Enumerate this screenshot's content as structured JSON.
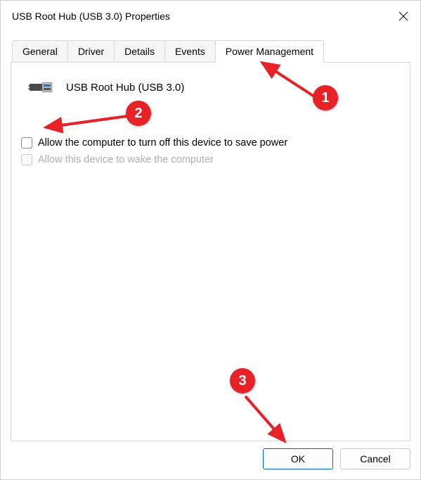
{
  "window": {
    "title": "USB Root Hub (USB 3.0) Properties"
  },
  "tabs": {
    "general": "General",
    "driver": "Driver",
    "details": "Details",
    "events": "Events",
    "power_management": "Power Management",
    "active": "power_management"
  },
  "device": {
    "name": "USB Root Hub (USB 3.0)"
  },
  "checkboxes": {
    "allow_turn_off": {
      "label": "Allow the computer to turn off this device to save power",
      "checked": false,
      "enabled": true
    },
    "allow_wake": {
      "label": "Allow this device to wake the computer",
      "checked": false,
      "enabled": false
    }
  },
  "buttons": {
    "ok": "OK",
    "cancel": "Cancel"
  },
  "annotations": {
    "one": "1",
    "two": "2",
    "three": "3"
  },
  "colors": {
    "accent": "#0067c0",
    "annotation": "#e82127"
  }
}
